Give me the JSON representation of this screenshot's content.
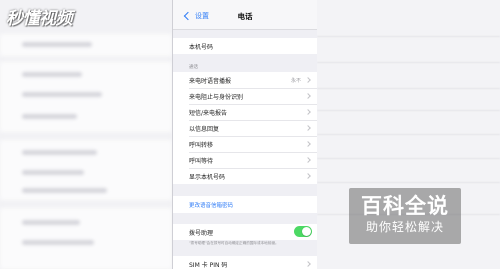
{
  "logo": {
    "text": "秒懂视频"
  },
  "nav": {
    "back_label": "设置",
    "title": "电话"
  },
  "my_number": {
    "label": "本机号码"
  },
  "calls_section": {
    "header": "通话",
    "items": [
      {
        "label": "来电时语音播报",
        "value": "永不"
      },
      {
        "label": "来电阻止与身份识别",
        "value": ""
      },
      {
        "label": "短信/来电报告",
        "value": ""
      },
      {
        "label": "以信息回复",
        "value": ""
      },
      {
        "label": "呼叫转移",
        "value": ""
      },
      {
        "label": "呼叫等待",
        "value": ""
      },
      {
        "label": "显示本机号码",
        "value": ""
      }
    ]
  },
  "voicemail": {
    "label": "更改语音信箱密码"
  },
  "dial_assist": {
    "label": "拨号助理",
    "enabled": true,
    "note": "\"拨号助理\"会在拨号时自动确定正确的国际或本地前缀。"
  },
  "sim": {
    "label": "SIM 卡 PIN 码"
  },
  "watermark": {
    "main": "百科全说",
    "sub": "助你轻松解决"
  },
  "colors": {
    "accent": "#2f7cf6",
    "toggle_on": "#4cd964"
  }
}
